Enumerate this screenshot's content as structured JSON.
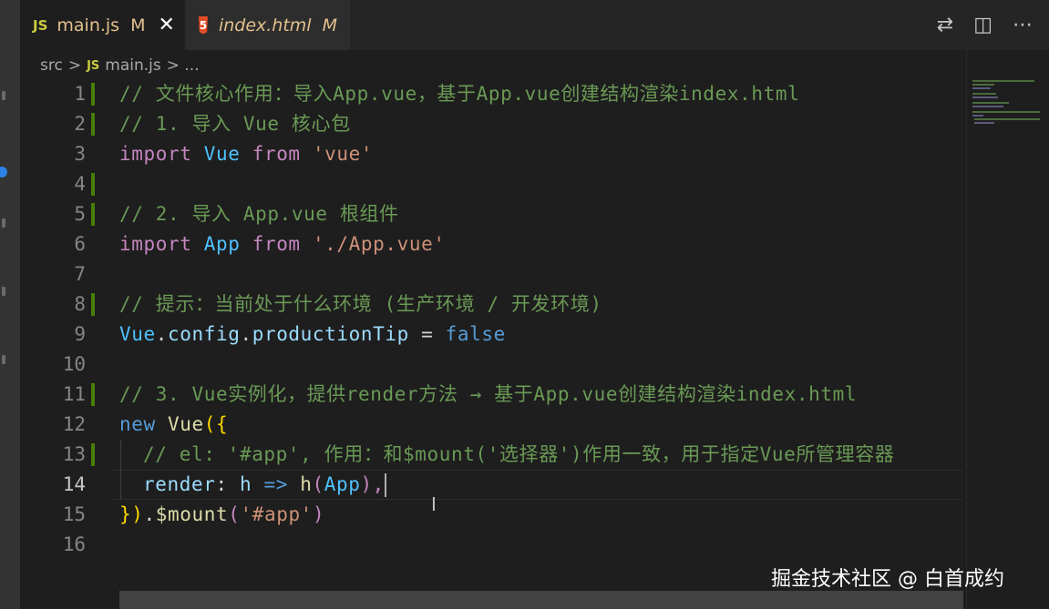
{
  "tabs": [
    {
      "icon": "JS",
      "label": "main.js",
      "status": "M",
      "close": "✕"
    },
    {
      "icon": "5",
      "label": "index.html",
      "status": "M"
    }
  ],
  "breadcrumb": {
    "folder": "src",
    "sep": ">",
    "icon": "JS",
    "file": "main.js",
    "more": "> ..."
  },
  "actions": {
    "compare_icon": "⇄",
    "split_icon": "◫",
    "more_icon": "⋯"
  },
  "lines": [
    {
      "num": "1"
    },
    {
      "num": "2"
    },
    {
      "num": "3"
    },
    {
      "num": "4"
    },
    {
      "num": "5"
    },
    {
      "num": "6"
    },
    {
      "num": "7"
    },
    {
      "num": "8"
    },
    {
      "num": "9"
    },
    {
      "num": "10"
    },
    {
      "num": "11"
    },
    {
      "num": "12"
    },
    {
      "num": "13"
    },
    {
      "num": "14"
    },
    {
      "num": "15"
    },
    {
      "num": "16"
    }
  ],
  "code": {
    "l1": "// 文件核心作用：导入App.vue，基于App.vue创建结构渲染index.html",
    "l2": "// 1. 导入 Vue 核心包",
    "l3": {
      "kw": "import",
      "name": "Vue",
      "from": "from",
      "str": "'vue'"
    },
    "l5": "// 2. 导入 App.vue 根组件",
    "l6": {
      "kw": "import",
      "name": "App",
      "from": "from",
      "str": "'./App.vue'"
    },
    "l8": "// 提示：当前处于什么环境 (生产环境 / 开发环境)",
    "l9": {
      "obj": "Vue",
      "dot1": ".",
      "p1": "config",
      "dot2": ".",
      "p2": "productionTip",
      "eq": " = ",
      "val": "false"
    },
    "l11": "// 3. Vue实例化，提供render方法 → 基于App.vue创建结构渲染index.html",
    "l12": {
      "kw": "new",
      "cls": "Vue",
      "open": "({"
    },
    "l13": "// el: '#app', 作用：和$mount('选择器')作用一致，用于指定Vue所管理容器",
    "l14": {
      "p": "render",
      "colon": ": ",
      "arg": "h",
      "arrow": " => ",
      "fn": "h",
      "open": "(",
      "x": "App",
      "close": "),"
    },
    "l15": {
      "close": "})",
      "dot": ".",
      "fn": "$mount",
      "open": "(",
      "str": "'#app'",
      "end": ")"
    }
  },
  "watermark": "掘金技术社区 @ 白首成约"
}
